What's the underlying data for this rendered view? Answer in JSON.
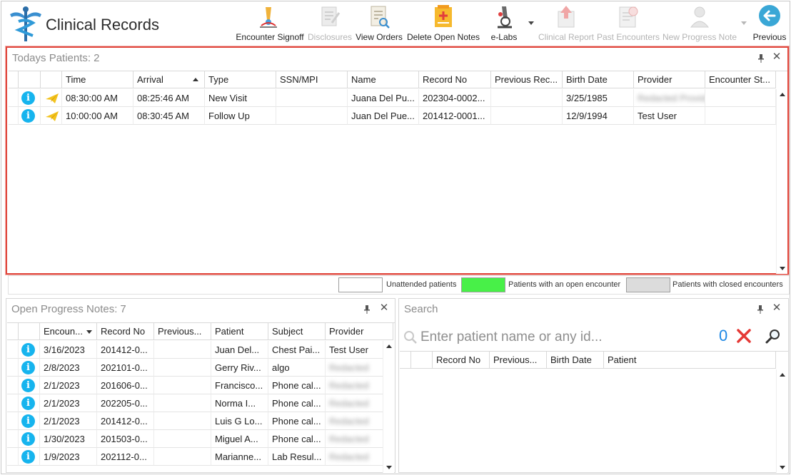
{
  "app": {
    "title": "Clinical Records"
  },
  "toolbar": {
    "buttons": [
      {
        "label": "Encounter Signoff",
        "icon": "encounter-signoff-icon",
        "enabled": true
      },
      {
        "label": "Disclosures",
        "icon": "disclosures-icon",
        "enabled": false
      },
      {
        "label": "View Orders",
        "icon": "view-orders-icon",
        "enabled": true
      },
      {
        "label": "Delete Open Notes",
        "icon": "delete-open-notes-icon",
        "enabled": true
      },
      {
        "label": "e-Labs",
        "icon": "microscope-icon",
        "enabled": true,
        "dropdown": true
      },
      {
        "label": "Clinical Report",
        "icon": "clinical-report-icon",
        "enabled": false
      },
      {
        "label": "Past Encounters",
        "icon": "past-encounters-icon",
        "enabled": false
      },
      {
        "label": "New Progress Note",
        "icon": "new-progress-note-icon",
        "enabled": false,
        "dropdown": true
      },
      {
        "label": "Previous",
        "icon": "arrow-left-icon",
        "enabled": true
      }
    ]
  },
  "todays_patients": {
    "title": "Todays Patients:",
    "count": "2",
    "columns": [
      "",
      "",
      "Time",
      "Arrival",
      "Type",
      "SSN/MPI",
      "Name",
      "Record No",
      "Previous Rec...",
      "Birth Date",
      "Provider",
      "Encounter St..."
    ],
    "sorted_column": "Arrival",
    "rows": [
      {
        "time": "08:30:00 AM",
        "arrival": "08:25:46 AM",
        "type": "New Visit",
        "ssn": "",
        "name": "Juana Del Pu...",
        "record_no": "202304-0002...",
        "previous": "",
        "birth_date": "3/25/1985",
        "provider": "Redacted Provider",
        "provider_blurred": true,
        "encounter_status": ""
      },
      {
        "time": "10:00:00 AM",
        "arrival": "08:30:45 AM",
        "type": "Follow Up",
        "ssn": "",
        "name": "Juan Del Pue...",
        "record_no": "201412-0001...",
        "previous": "",
        "birth_date": "12/9/1994",
        "provider": "Test User",
        "provider_blurred": false,
        "encounter_status": ""
      }
    ]
  },
  "legend": {
    "items": [
      {
        "label": "Unattended patients",
        "color": "#ffffff"
      },
      {
        "label": "Patients with an open encounter",
        "color": "#48f048"
      },
      {
        "label": "Patients with closed encounters",
        "color": "#dcdcdc"
      }
    ]
  },
  "open_progress_notes": {
    "title": "Open Progress Notes:",
    "count": "7",
    "columns": [
      "",
      "Encoun...",
      "Record No",
      "Previous...",
      "Patient",
      "Subject",
      "Provider"
    ],
    "rows": [
      {
        "encounter": "3/16/2023",
        "record_no": "201412-0...",
        "previous": "",
        "patient": "Juan Del...",
        "subject": "Chest Pai...",
        "provider": "Test User",
        "provider_blurred": false
      },
      {
        "encounter": "2/8/2023",
        "record_no": "202101-0...",
        "previous": "",
        "patient": "Gerry Riv...",
        "subject": "algo",
        "provider": "Redacted",
        "provider_blurred": true
      },
      {
        "encounter": "2/1/2023",
        "record_no": "201606-0...",
        "previous": "",
        "patient": "Francisco...",
        "subject": "Phone cal...",
        "provider": "Redacted",
        "provider_blurred": true
      },
      {
        "encounter": "2/1/2023",
        "record_no": "202205-0...",
        "previous": "",
        "patient": "Norma I...",
        "subject": "Phone cal...",
        "provider": "Redacted",
        "provider_blurred": true
      },
      {
        "encounter": "2/1/2023",
        "record_no": "201412-0...",
        "previous": "",
        "patient": "Luis G Lo...",
        "subject": "Phone cal...",
        "provider": "Redacted",
        "provider_blurred": true
      },
      {
        "encounter": "1/30/2023",
        "record_no": "201503-0...",
        "previous": "",
        "patient": "Miguel A...",
        "subject": "Phone cal...",
        "provider": "Redacted",
        "provider_blurred": true
      },
      {
        "encounter": "1/9/2023",
        "record_no": "202112-0...",
        "previous": "",
        "patient": "Marianne...",
        "subject": "Lab Resul...",
        "provider": "Redacted",
        "provider_blurred": true
      }
    ]
  },
  "search": {
    "title": "Search",
    "placeholder": "Enter patient name or any id...",
    "result_count": "0",
    "columns": [
      "",
      "Record No",
      "Previous...",
      "Birth Date",
      "Patient"
    ]
  },
  "colors": {
    "highlight": "#e0463c",
    "info": "#16b4ee",
    "count": "#1e88e5",
    "clear": "#e53935"
  }
}
